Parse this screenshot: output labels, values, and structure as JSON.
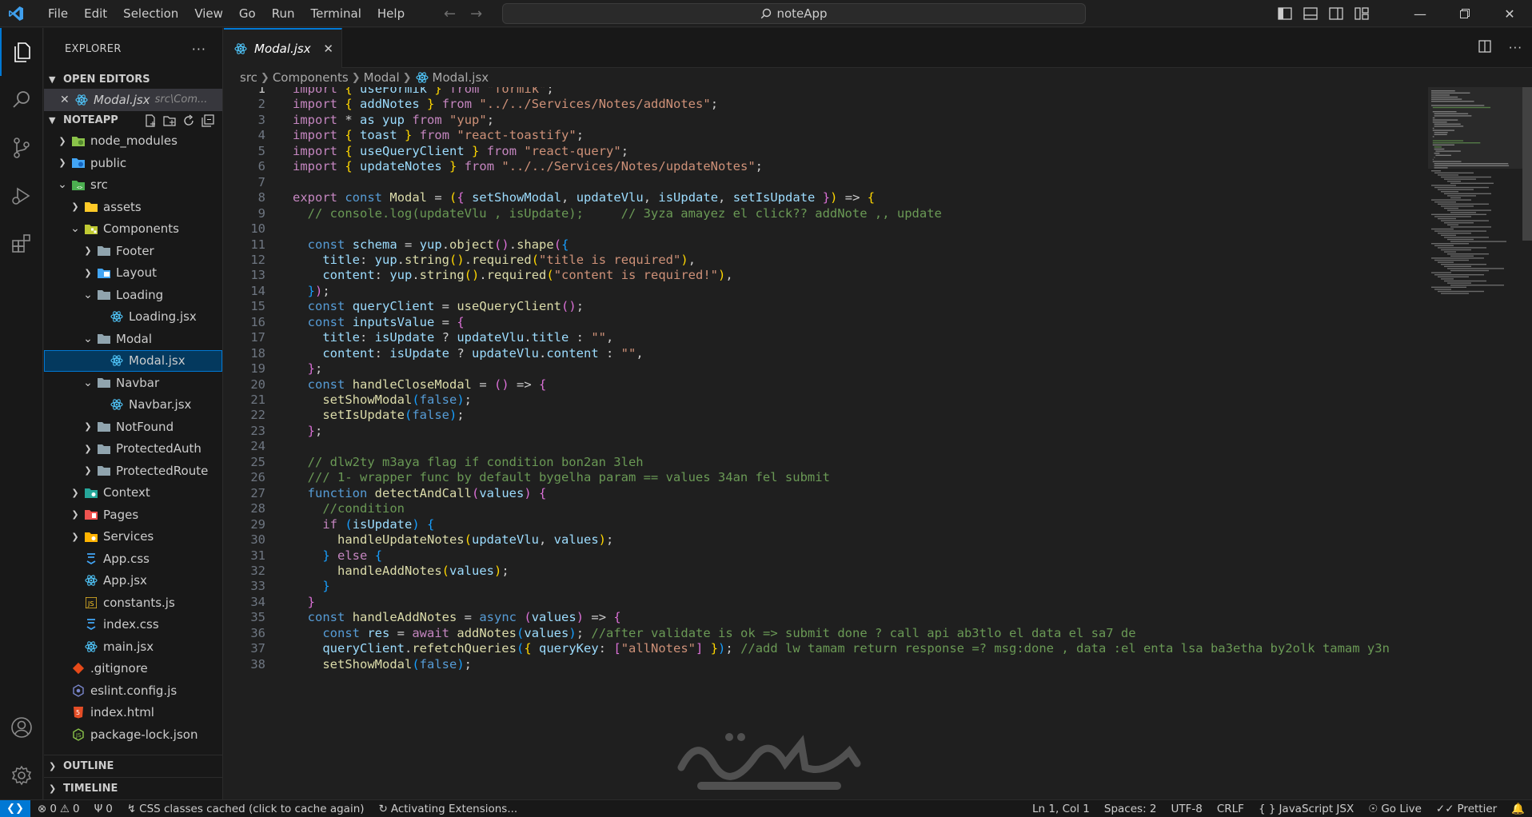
{
  "titlebar": {
    "menu": [
      "File",
      "Edit",
      "Selection",
      "View",
      "Go",
      "Run",
      "Terminal",
      "Help"
    ],
    "search_text": "noteApp"
  },
  "sidebar": {
    "title": "EXPLORER",
    "open_editors_label": "OPEN EDITORS",
    "open_editor": {
      "name": "Modal.jsx",
      "hint": "src\\Com..."
    },
    "project_label": "NOTEAPP",
    "tree": [
      {
        "label": "node_modules",
        "depth": 0,
        "kind": "folder",
        "icon": "node-folder-icon",
        "expanded": false
      },
      {
        "label": "public",
        "depth": 0,
        "kind": "folder",
        "icon": "globe-folder-icon",
        "expanded": false
      },
      {
        "label": "src",
        "depth": 0,
        "kind": "folder",
        "icon": "src-folder-icon",
        "expanded": true
      },
      {
        "label": "assets",
        "depth": 1,
        "kind": "folder",
        "icon": "assets-folder-icon",
        "expanded": false
      },
      {
        "label": "Components",
        "depth": 1,
        "kind": "folder",
        "icon": "components-folder-icon",
        "expanded": true
      },
      {
        "label": "Footer",
        "depth": 2,
        "kind": "folder",
        "icon": "folder-icon",
        "expanded": false
      },
      {
        "label": "Layout",
        "depth": 2,
        "kind": "folder",
        "icon": "layout-folder-icon",
        "expanded": false
      },
      {
        "label": "Loading",
        "depth": 2,
        "kind": "folder",
        "icon": "folder-icon",
        "expanded": true
      },
      {
        "label": "Loading.jsx",
        "depth": 3,
        "kind": "file",
        "icon": "react-icon"
      },
      {
        "label": "Modal",
        "depth": 2,
        "kind": "folder",
        "icon": "folder-icon",
        "expanded": true
      },
      {
        "label": "Modal.jsx",
        "depth": 3,
        "kind": "file",
        "icon": "react-icon",
        "active": true
      },
      {
        "label": "Navbar",
        "depth": 2,
        "kind": "folder",
        "icon": "folder-icon",
        "expanded": true
      },
      {
        "label": "Navbar.jsx",
        "depth": 3,
        "kind": "file",
        "icon": "react-icon"
      },
      {
        "label": "NotFound",
        "depth": 2,
        "kind": "folder",
        "icon": "folder-icon",
        "expanded": false
      },
      {
        "label": "ProtectedAuth",
        "depth": 2,
        "kind": "folder",
        "icon": "folder-icon",
        "expanded": false
      },
      {
        "label": "ProtectedRoute",
        "depth": 2,
        "kind": "folder",
        "icon": "folder-icon",
        "expanded": false
      },
      {
        "label": "Context",
        "depth": 1,
        "kind": "folder",
        "icon": "context-folder-icon",
        "expanded": false
      },
      {
        "label": "Pages",
        "depth": 1,
        "kind": "folder",
        "icon": "pages-folder-icon",
        "expanded": false
      },
      {
        "label": "Services",
        "depth": 1,
        "kind": "folder",
        "icon": "services-folder-icon",
        "expanded": false
      },
      {
        "label": "App.css",
        "depth": 1,
        "kind": "file",
        "icon": "css-icon"
      },
      {
        "label": "App.jsx",
        "depth": 1,
        "kind": "file",
        "icon": "react-icon"
      },
      {
        "label": "constants.js",
        "depth": 1,
        "kind": "file",
        "icon": "js-icon"
      },
      {
        "label": "index.css",
        "depth": 1,
        "kind": "file",
        "icon": "css-icon"
      },
      {
        "label": "main.jsx",
        "depth": 1,
        "kind": "file",
        "icon": "react-icon"
      },
      {
        "label": ".gitignore",
        "depth": 0,
        "kind": "file",
        "icon": "git-icon"
      },
      {
        "label": "eslint.config.js",
        "depth": 0,
        "kind": "file",
        "icon": "eslint-icon"
      },
      {
        "label": "index.html",
        "depth": 0,
        "kind": "file",
        "icon": "html-icon"
      },
      {
        "label": "package-lock.json",
        "depth": 0,
        "kind": "file",
        "icon": "node-json-icon"
      }
    ],
    "outline_label": "OUTLINE",
    "timeline_label": "TIMELINE"
  },
  "editor": {
    "tab_label": "Modal.jsx",
    "breadcrumb": [
      "src",
      "Components",
      "Modal",
      "Modal.jsx"
    ],
    "current_line": 1,
    "lines": [
      "import { useFormik } from \"formik\";",
      "import { addNotes } from \"../../Services/Notes/addNotes\";",
      "import * as yup from \"yup\";",
      "import { toast } from \"react-toastify\";",
      "import { useQueryClient } from \"react-query\";",
      "import { updateNotes } from \"../../Services/Notes/updateNotes\";",
      "",
      "export const Modal = ({ setShowModal, updateVlu, isUpdate, setIsUpdate }) => {",
      "  // console.log(updateVlu , isUpdate);     // 3yza amayez el click?? addNote ,, update",
      "",
      "  const schema = yup.object().shape({",
      "    title: yup.string().required(\"title is required\"),",
      "    content: yup.string().required(\"content is required!\"),",
      "  });",
      "  const queryClient = useQueryClient();",
      "  const inputsValue = {",
      "    title: isUpdate ? updateVlu.title : \"\",",
      "    content: isUpdate ? updateVlu.content : \"\",",
      "  };",
      "  const handleCloseModal = () => {",
      "    setShowModal(false);",
      "    setIsUpdate(false);",
      "  };",
      "",
      "  // dlw2ty m3aya flag if condition bon2an 3leh",
      "  /// 1- wrapper func by default bygelha param == values 34an fel submit",
      "  function detectAndCall(values) {",
      "    //condition",
      "    if (isUpdate) {",
      "      handleUpdateNotes(updateVlu, values);",
      "    } else {",
      "      handleAddNotes(values);",
      "    }",
      "  }",
      "  const handleAddNotes = async (values) => {",
      "    const res = await addNotes(values); //after validate is ok => submit done ? call api ab3tlo el data el sa7 de",
      "    queryClient.refetchQueries({ queryKey: [\"allNotes\"] }); //add lw tamam return response =? msg:done , data :el enta lsa ba3etha by2olk tamam y3n",
      "    setShowModal(false);"
    ]
  },
  "statusbar": {
    "errors": "0",
    "warnings": "0",
    "ports": "0",
    "css_cache": "CSS classes cached (click to cache again)",
    "activating": "Activating Extensions...",
    "position": "Ln 1, Col 1",
    "spaces": "Spaces: 2",
    "encoding": "UTF-8",
    "eol": "CRLF",
    "language": "JavaScript JSX",
    "golive": "Go Live",
    "prettier": "Prettier"
  },
  "colors": {
    "accent": "#0078d4",
    "keyword": "#c586c0",
    "storage": "#569cd6",
    "variable": "#9cdcfe",
    "function": "#dcdcaa",
    "string": "#ce9178",
    "comment": "#6a9955",
    "brace1": "#ffd700",
    "brace2": "#da70d6",
    "brace3": "#179fff"
  }
}
